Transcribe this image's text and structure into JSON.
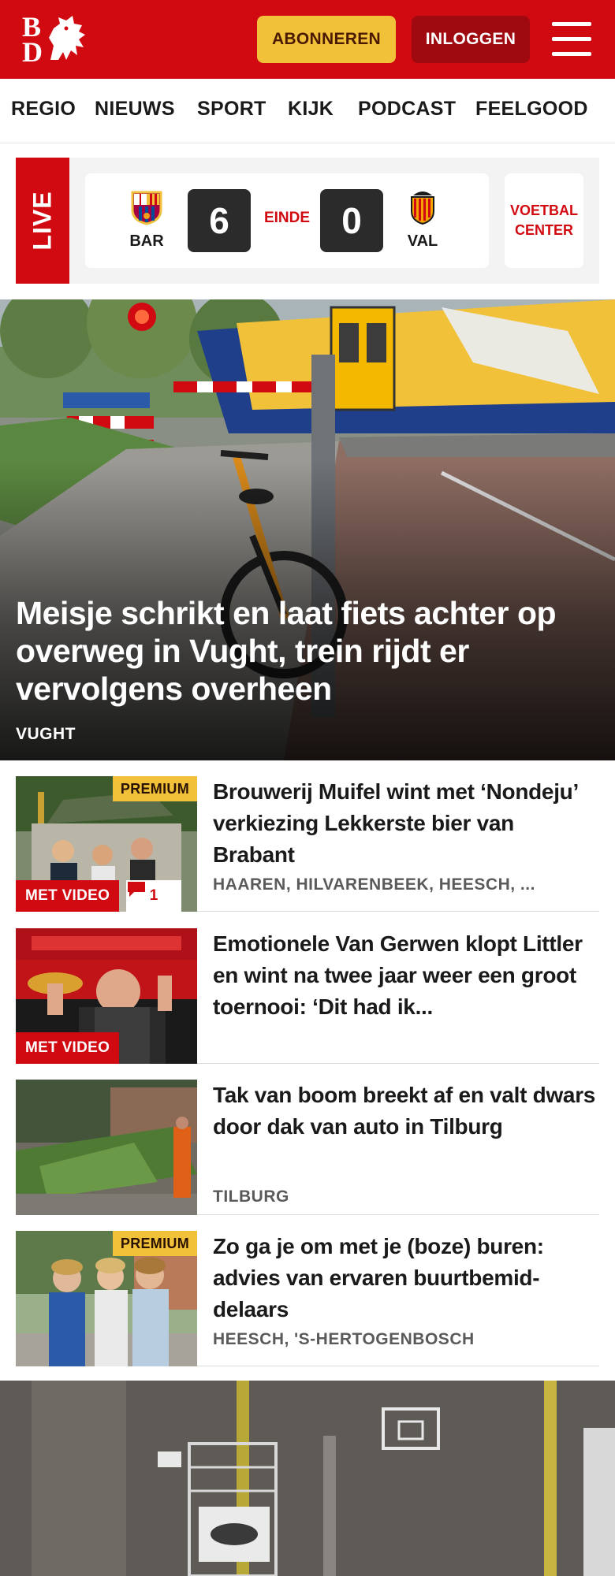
{
  "header": {
    "logo_letters": "BD",
    "subscribe_label": "ABONNEREN",
    "login_label": "INLOGGEN"
  },
  "nav": {
    "items": [
      "REGIO",
      "NIEUWS",
      "SPORT",
      "KIJK",
      "PODCAST",
      "FEELGOOD"
    ]
  },
  "live": {
    "tag": "LIVE",
    "home_team": "BAR",
    "away_team": "VAL",
    "home_score": "6",
    "away_score": "0",
    "status": "EINDE",
    "center_label_1": "VOETBAL",
    "center_label_2": "CENTER"
  },
  "hero": {
    "title": "Meisje schrikt en laat fiets achter op overweg in Vught, trein rijdt er vervolgens overheen",
    "location": "VUGHT"
  },
  "articles": [
    {
      "title": "Brouwerij Muifel wint met ‘Nondeju’ verkiezing Lekkerste bier van Brabant",
      "location": "HAAREN, HILVARENBEEK, HEESCH, ...",
      "premium": "PREMIUM",
      "video": "MET VIDEO",
      "comments": "1"
    },
    {
      "title": "Emotionele Van Gerwen klopt Littler en wint na twee jaar weer een groot toernooi: ‘Dit had ik...",
      "video": "MET VIDEO"
    },
    {
      "title": "Tak van boom breekt af en valt dwars door dak van auto in Tilburg",
      "location": "TILBURG"
    },
    {
      "title": "Zo ga je om met je (boze) buren: advies van ervaren buurtbemid­delaars",
      "location": "HEESCH, 'S-HERTOGENBOSCH",
      "premium": "PREMIUM"
    }
  ],
  "colors": {
    "brand_red": "#d10a11",
    "premium_yellow": "#f2c13a",
    "login_dark_red": "#9e0a10"
  }
}
